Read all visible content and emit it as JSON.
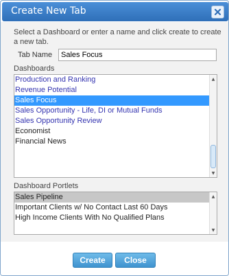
{
  "dialog": {
    "title": "Create New Tab",
    "instructions": "Select a Dashboard or enter a name and click create to create a new tab."
  },
  "tab_name": {
    "label": "Tab Name",
    "value": "Sales Focus"
  },
  "dashboards": {
    "label": "Dashboards",
    "items": [
      {
        "label": "Production and Ranking"
      },
      {
        "label": "Revenue Potential"
      },
      {
        "label": "Sales Focus"
      },
      {
        "label": "Sales Opportunity - Life, DI or Mutual Funds"
      },
      {
        "label": "Sales Opportunity Review"
      },
      {
        "label": "Economist"
      },
      {
        "label": "Financial News"
      }
    ],
    "selected": "Sales Focus"
  },
  "portlets": {
    "label": "Dashboard Portlets",
    "items": [
      {
        "label": "Sales Pipeline"
      },
      {
        "label": "Important Clients w/ No Contact Last 60 Days"
      },
      {
        "label": "High Income Clients With No Qualified Plans"
      }
    ]
  },
  "buttons": {
    "create": "Create",
    "close": "Close"
  },
  "colors": {
    "title_bar": "#2f6fb8",
    "selection": "#3399ff",
    "link_text": "#3434b0",
    "button": "#3f93cf"
  }
}
